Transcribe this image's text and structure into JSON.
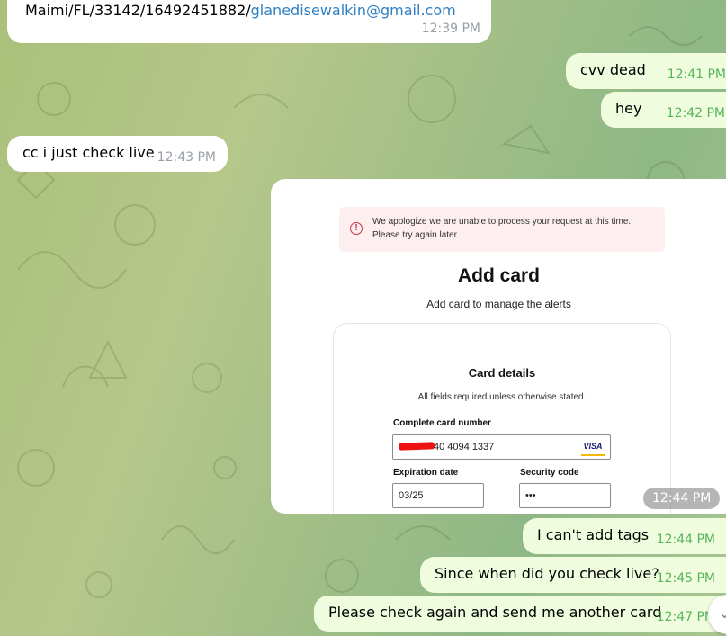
{
  "messages": [
    {
      "text_prefix": "Maimi/FL/33142/16492451882/",
      "link": "glanedisewalkin@gmail.com",
      "time": "12:39 PM"
    },
    {
      "text": "cvv dead",
      "time": "12:41 PM"
    },
    {
      "text": "hey",
      "time": "12:42 PM"
    },
    {
      "text": "cc i just check live",
      "time": "12:43 PM"
    },
    {
      "time": "12:44 PM"
    },
    {
      "text": "I can't add tags",
      "time": "12:44 PM"
    },
    {
      "text": "Since when did you check live?",
      "time": "12:45 PM"
    },
    {
      "text": "Please check again and send me another card",
      "time": "12:47 PM"
    }
  ],
  "screenshot": {
    "error_text": "We apologize we are unable to process your request at this time. Please try again later.",
    "title": "Add card",
    "subtitle": "Add card to manage the alerts",
    "panel_title": "Card details",
    "panel_subtitle": "All fields required unless otherwise stated.",
    "card_number_label": "Complete card number",
    "card_number_value": "40 4094 1337",
    "card_brand": "VISA",
    "expiration_label": "Expiration date",
    "expiration_value": "03/25",
    "security_label": "Security code",
    "security_value": "•••"
  },
  "colors": {
    "incoming": "#ffffff",
    "outgoing": "#effdde",
    "outgoing_time": "#57b45b",
    "link": "#2f7fc1"
  }
}
